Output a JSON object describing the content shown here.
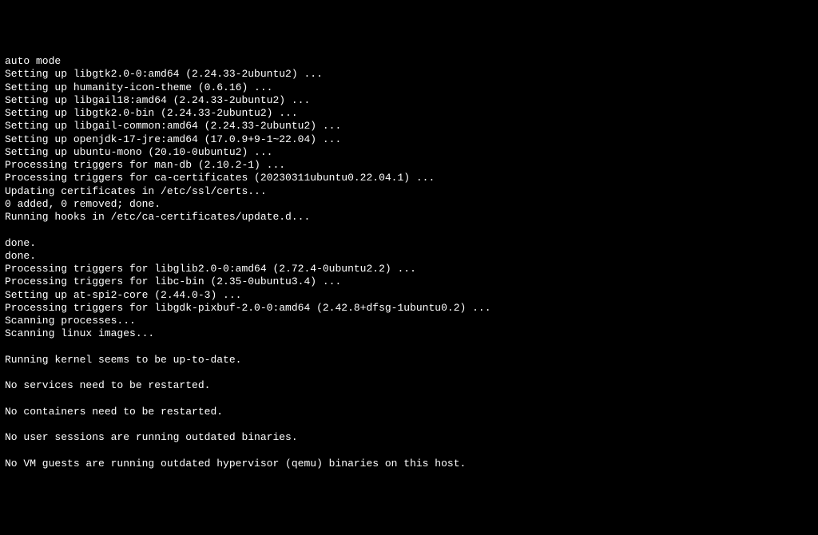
{
  "terminal": {
    "lines": [
      "auto mode",
      "Setting up libgtk2.0-0:amd64 (2.24.33-2ubuntu2) ...",
      "Setting up humanity-icon-theme (0.6.16) ...",
      "Setting up libgail18:amd64 (2.24.33-2ubuntu2) ...",
      "Setting up libgtk2.0-bin (2.24.33-2ubuntu2) ...",
      "Setting up libgail-common:amd64 (2.24.33-2ubuntu2) ...",
      "Setting up openjdk-17-jre:amd64 (17.0.9+9-1~22.04) ...",
      "Setting up ubuntu-mono (20.10-0ubuntu2) ...",
      "Processing triggers for man-db (2.10.2-1) ...",
      "Processing triggers for ca-certificates (20230311ubuntu0.22.04.1) ...",
      "Updating certificates in /etc/ssl/certs...",
      "0 added, 0 removed; done.",
      "Running hooks in /etc/ca-certificates/update.d...",
      "",
      "done.",
      "done.",
      "Processing triggers for libglib2.0-0:amd64 (2.72.4-0ubuntu2.2) ...",
      "Processing triggers for libc-bin (2.35-0ubuntu3.4) ...",
      "Setting up at-spi2-core (2.44.0-3) ...",
      "Processing triggers for libgdk-pixbuf-2.0-0:amd64 (2.42.8+dfsg-1ubuntu0.2) ...",
      "Scanning processes...",
      "Scanning linux images...",
      "",
      "Running kernel seems to be up-to-date.",
      "",
      "No services need to be restarted.",
      "",
      "No containers need to be restarted.",
      "",
      "No user sessions are running outdated binaries.",
      "",
      "No VM guests are running outdated hypervisor (qemu) binaries on this host."
    ]
  }
}
